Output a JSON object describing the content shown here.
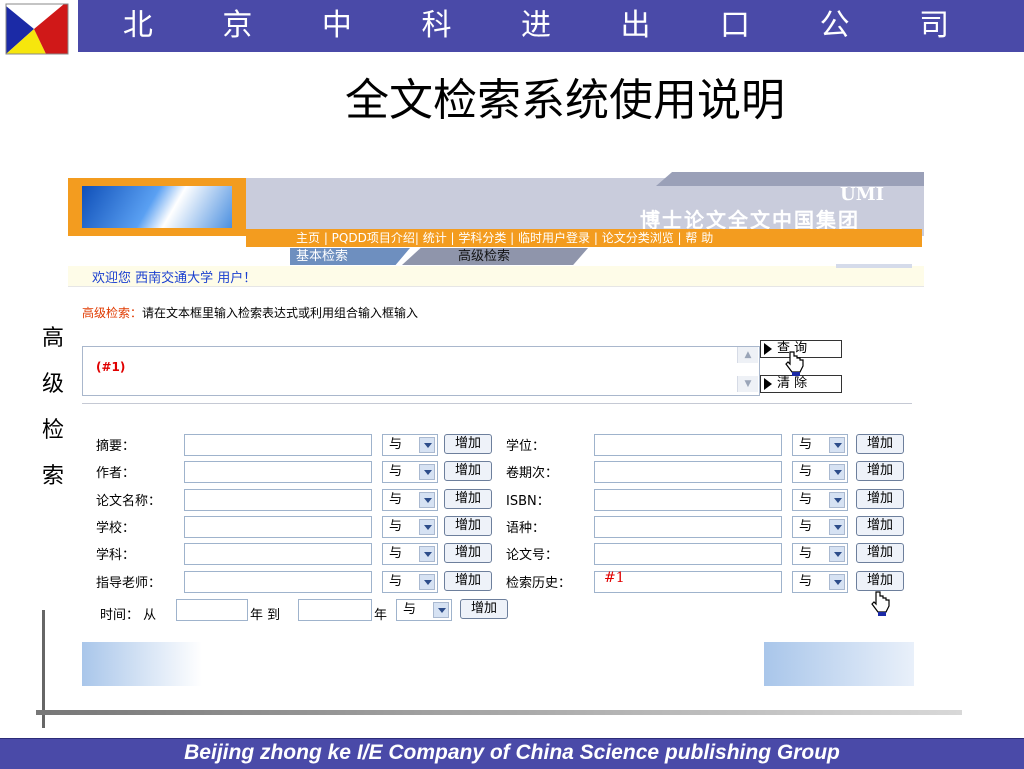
{
  "header": {
    "company": "北 京 中 科 进 出 口 公 司"
  },
  "page_title": "全文检索系统使用说明",
  "side_label": [
    "高",
    "级",
    "检",
    "索"
  ],
  "banner": {
    "brand": "UMI",
    "title": "博士论文全文中国集团"
  },
  "nav": {
    "items": "主页 | PQDD项目介绍| 统计 | 学科分类 | 临时用户登录 | 论文分类浏览 | 帮 助"
  },
  "tabs": {
    "basic": "基本检索",
    "advanced": "高级检索"
  },
  "welcome": "欢迎您 西南交通大学 用户！",
  "hint": {
    "label": "高级检索：",
    "text": "请在文本框里输入检索表达式或利用组合输入框输入"
  },
  "query": {
    "value": "(#1)"
  },
  "buttons": {
    "query": "查 询",
    "clear": "清 除"
  },
  "form": {
    "operator": "与",
    "add": "增加",
    "left_fields": [
      "摘要：",
      "作者：",
      "论文名称：",
      "学校：",
      "学科：",
      "指导老师："
    ],
    "right_fields": [
      "学位：",
      "卷期次：",
      "ISBN：",
      "语种：",
      "论文号：",
      "检索历史："
    ],
    "history_value": "#1",
    "time": {
      "label": "时间：",
      "from": "从",
      "year": "年",
      "to": "到"
    }
  },
  "footer": "Beijing  zhong ke I/E Company of China Science publishing Group",
  "colors": {
    "header_bar": "#4a4aa8",
    "banner_orange": "#f39c1f",
    "link_blue": "#1a3fd0",
    "label_red": "#e03a00"
  }
}
